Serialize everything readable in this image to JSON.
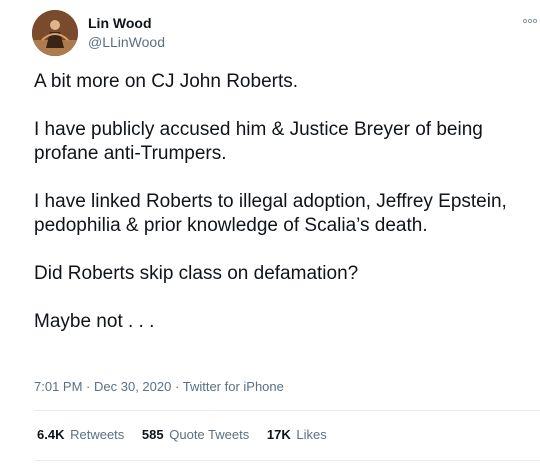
{
  "author": {
    "name": "Lin Wood",
    "handle": "@LLinWood"
  },
  "tweet": {
    "paragraphs": [
      "A bit more on CJ John Roberts.",
      "I have publicly accused him & Justice Breyer of being profane anti-Trumpers.",
      "I have linked Roberts to illegal adoption, Jeffrey Epstein, pedophilia & prior knowledge of Scalia’s death.",
      "Did Roberts skip class on defamation?",
      "Maybe not . . ."
    ]
  },
  "meta": {
    "time": "7:01 PM",
    "date": "Dec 30, 2020",
    "source": "Twitter for iPhone",
    "separator": "·"
  },
  "stats": {
    "retweets_count": "6.4K",
    "retweets_label": "Retweets",
    "quote_tweets_count": "585",
    "quote_tweets_label": "Quote Tweets",
    "likes_count": "17K",
    "likes_label": "Likes"
  },
  "icons": {
    "more": "more-options-icon"
  },
  "colors": {
    "text_primary": "#0f1419",
    "text_secondary": "#5b7083",
    "divider": "#e6ecf0"
  }
}
